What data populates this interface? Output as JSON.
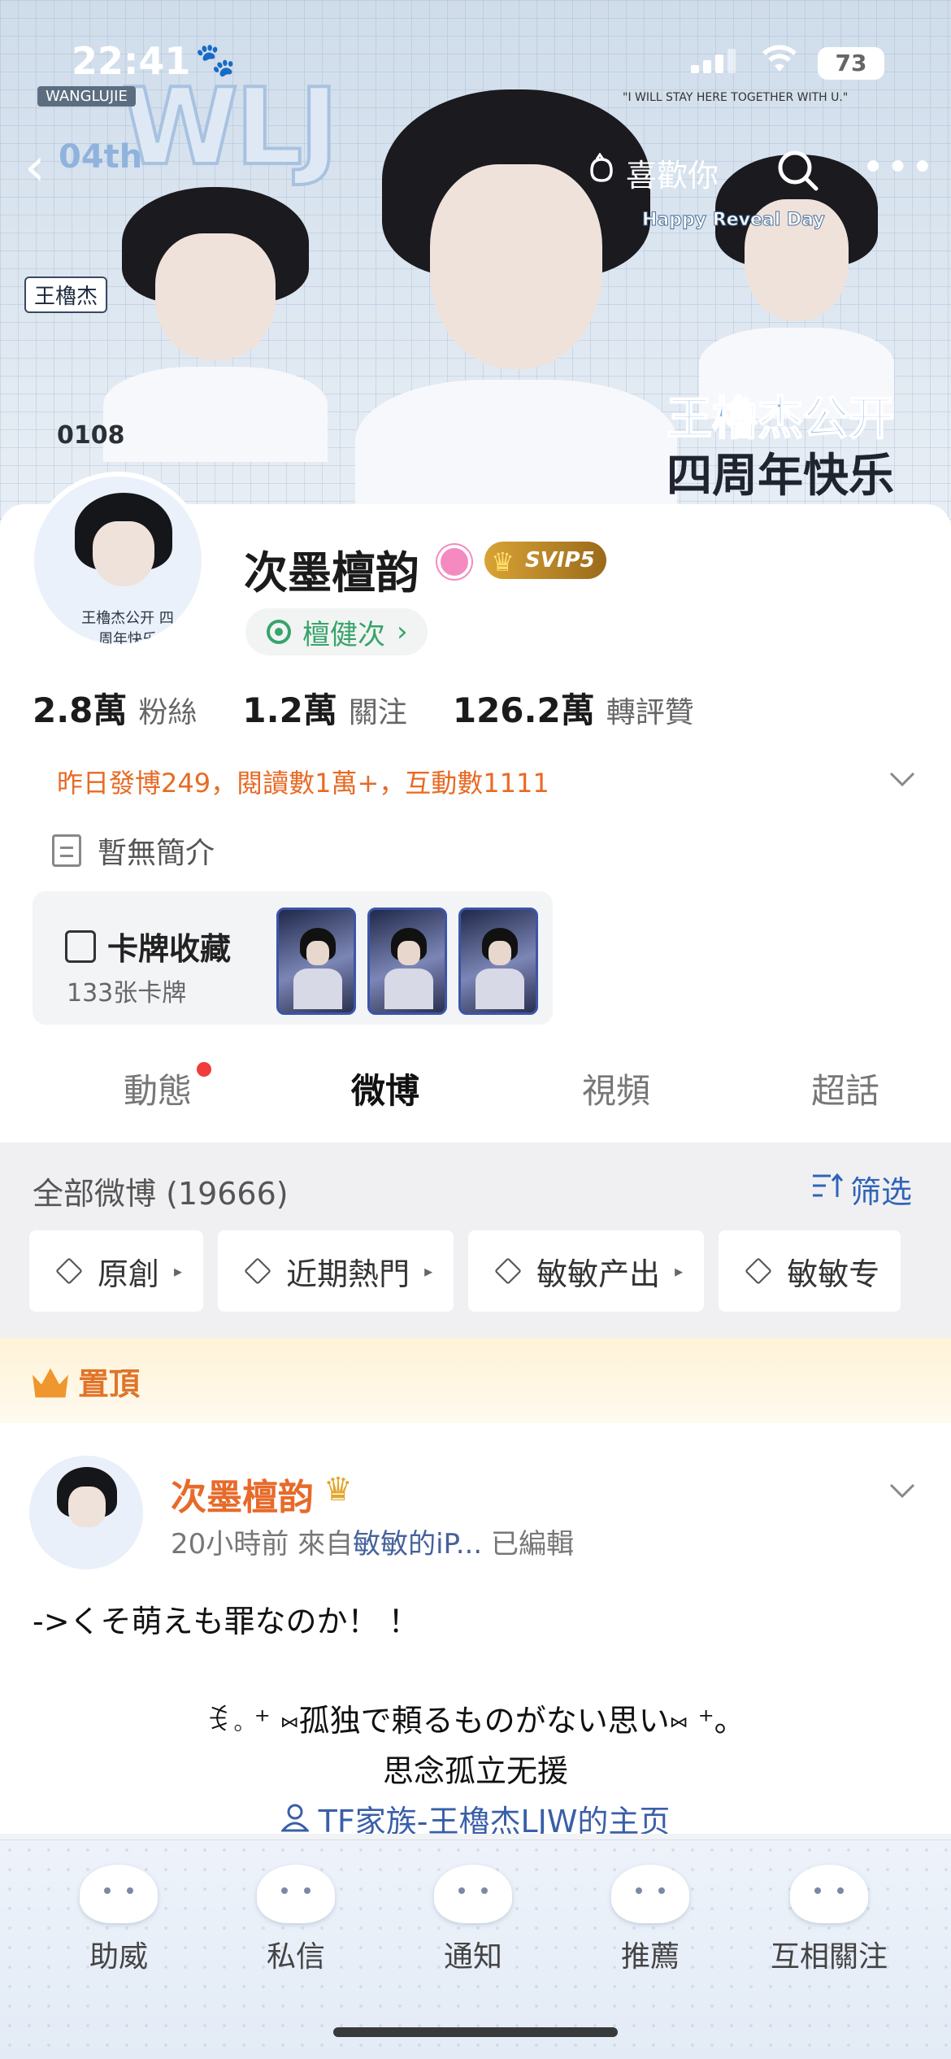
{
  "status_bar": {
    "time": "22:41",
    "battery": "73"
  },
  "banner": {
    "brand_tag": "WANGLUJIE",
    "logo_text": "WLJ",
    "badge_04": "04th",
    "badge_name": "王櫓杰",
    "date_tag": "0108",
    "english_line": "\"I WILL STAY HERE TOGETHER WITH U.\"",
    "reveal_text": "Happy Reveal Day",
    "title_line1": "王櫓杰公开",
    "title_line2": "四周年快乐"
  },
  "nav": {
    "like_label": "喜歡你"
  },
  "profile": {
    "name": "次墨檀韵",
    "vip_label": "SVIP5",
    "tag_label": "檀健次",
    "avatar_caption": "王櫓杰公开 四周年快乐",
    "stats": [
      {
        "value": "2.8萬",
        "label": "粉絲"
      },
      {
        "value": "1.2萬",
        "label": "關注"
      },
      {
        "value": "126.2萬",
        "label": "轉評贊"
      }
    ],
    "activity": "昨日發博249，閱讀數1萬+，互動數1111",
    "bio": "暫無簡介",
    "cards": {
      "title": "卡牌收藏",
      "count": "133张卡牌"
    }
  },
  "tabs": [
    {
      "label": "動態"
    },
    {
      "label": "微博"
    },
    {
      "label": "視頻"
    },
    {
      "label": "超話"
    }
  ],
  "filter": {
    "all_count": "全部微博 (19666)",
    "filter_label": "筛选",
    "chips": [
      {
        "label": "原創"
      },
      {
        "label": "近期熱門"
      },
      {
        "label": "敏敏产出"
      },
      {
        "label": "敏敏专"
      }
    ]
  },
  "pinned_post": {
    "pinned_label": "置頂",
    "author": "次墨檀韵",
    "meta_time": "20小時前",
    "meta_from": "來自",
    "meta_source": "敏敏的iP...",
    "meta_edited": "已編輯",
    "text_line1": "->くそ萌えも罪なのか！ ！",
    "text_line2": "ꉂ。⁺ ⑅孤独で頼るものがない思い⑅ ⁺。",
    "text_line3": "思念孤立无援",
    "link": "TF家族-王櫓杰LJW的主页"
  },
  "bottom_nav": [
    {
      "label": "助威"
    },
    {
      "label": "私信"
    },
    {
      "label": "通知"
    },
    {
      "label": "推薦"
    },
    {
      "label": "互相關注"
    }
  ],
  "colors": {
    "accent_orange": "#e86a24",
    "link_blue": "#3a5fa8",
    "tag_green": "#38a46b"
  }
}
